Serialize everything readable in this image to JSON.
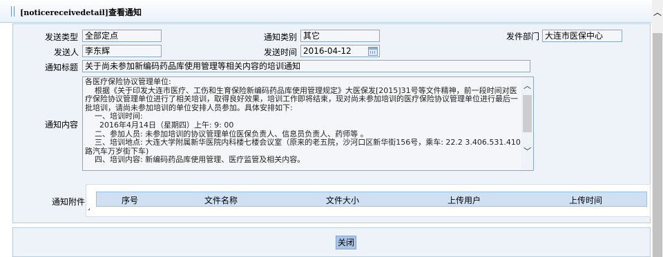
{
  "title": {
    "code": "[noticereceivedetail]",
    "text": "查看通知"
  },
  "form": {
    "send_type": {
      "label": "发送类型",
      "value": "全部定点"
    },
    "notice_category": {
      "label": "通知类别",
      "value": "其它"
    },
    "send_department": {
      "label": "发件部门",
      "value": "大连市医保中心"
    },
    "sender": {
      "label": "发送人",
      "value": "李东辉"
    },
    "send_time": {
      "label": "发送时间",
      "value": "2016-04-12"
    },
    "notice_title": {
      "label": "通知标题",
      "value": "关于尚未参加新编码药品库使用管理等相关内容的培训通知"
    },
    "notice_content": {
      "label": "通知内容",
      "value": "各医疗保险协议管理单位:\n    根据《关于印发大连市医疗、工伤和生育保险新编码药品库使用管理规定》大医保发[2015]31号等文件精神，前一段时间对医疗保险协议管理单位进行了相关培训，取得良好效果，培训工作即将结束，现对尚未参加培训的医疗保险协议管理单位进行最后一批培训，请尚未参加培训的单位安排人员参加。具体安排如下:\n    一、培训时间:\n      2016年4月14日（星期四）上午: 9: 00\n    二、参加人员: 未参加培训的协议管理单位医保负责人、信息员负责人、药师等 。\n    三、培训地点: 大连大学附属新华医院内科楼七楼会议室（原来的老五院，沙河口区新华街156号，乘车: 22.2 3.406.531.410路汽车万岁街下车)\n    四、培训内容: 新编码药品库使用管理、医疗监管及相关内容。"
    }
  },
  "attachments": {
    "label": "通知附件",
    "columns": [
      "序号",
      "文件名称",
      "文件大小",
      "上传用户",
      "上传时间"
    ],
    "rows": []
  },
  "buttons": {
    "close": "关闭"
  },
  "colors": {
    "panel_bg": "#eef3fa",
    "border": "#b9cde0",
    "field_border": "#8aa6c8",
    "header_bg": "#cfe0f3",
    "button_bg": "#a9c6e6"
  }
}
